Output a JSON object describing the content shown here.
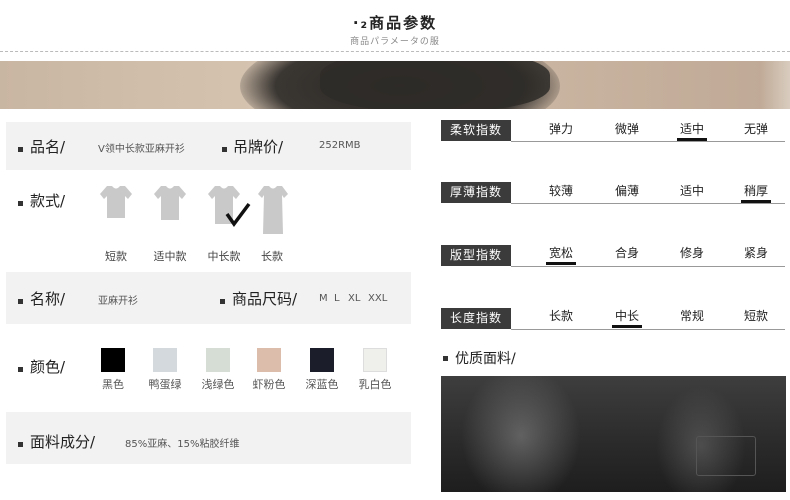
{
  "header": {
    "title": "·₂商品参数",
    "subtitle": "商品パラメータの服"
  },
  "left": {
    "name_label": "品名/",
    "name_value": "V领中长款亚麻开衫",
    "price_label": "吊牌价/",
    "price_value": "252RMB",
    "style_label": "款式/",
    "styles": [
      {
        "label": "短款"
      },
      {
        "label": "适中款"
      },
      {
        "label": "中长款",
        "selected": true
      },
      {
        "label": "长款"
      }
    ],
    "check_mark": "√",
    "title_label": "名称/",
    "title_value": "亚麻开衫",
    "size_label": "商品尺码/",
    "sizes": [
      "M",
      "L",
      "XL",
      "XXL"
    ],
    "color_label": "颜色/",
    "colors": [
      {
        "name": "黑色",
        "hex": "#000000"
      },
      {
        "name": "鸭蛋绿",
        "hex": "#d3d9dc"
      },
      {
        "name": "浅绿色",
        "hex": "#d6ddd4"
      },
      {
        "name": "虾粉色",
        "hex": "#dcbcab"
      },
      {
        "name": "深蓝色",
        "hex": "#1b1d2a"
      },
      {
        "name": "乳白色",
        "hex": "#efefeb"
      }
    ],
    "fabric_label": "面料成分/",
    "fabric_value": "85%亚麻、15%粘胶纤维"
  },
  "right": {
    "indices": [
      {
        "title": "柔软指数",
        "options": [
          "弹力",
          "微弹",
          "适中",
          "无弹"
        ],
        "selected": 2
      },
      {
        "title": "厚薄指数",
        "options": [
          "较薄",
          "偏薄",
          "适中",
          "稍厚"
        ],
        "selected": 3
      },
      {
        "title": "版型指数",
        "options": [
          "宽松",
          "合身",
          "修身",
          "紧身"
        ],
        "selected": 0
      },
      {
        "title": "长度指数",
        "options": [
          "长款",
          "中长",
          "常规",
          "短款"
        ],
        "selected": 1
      }
    ],
    "quality_title": "优质面料/"
  }
}
